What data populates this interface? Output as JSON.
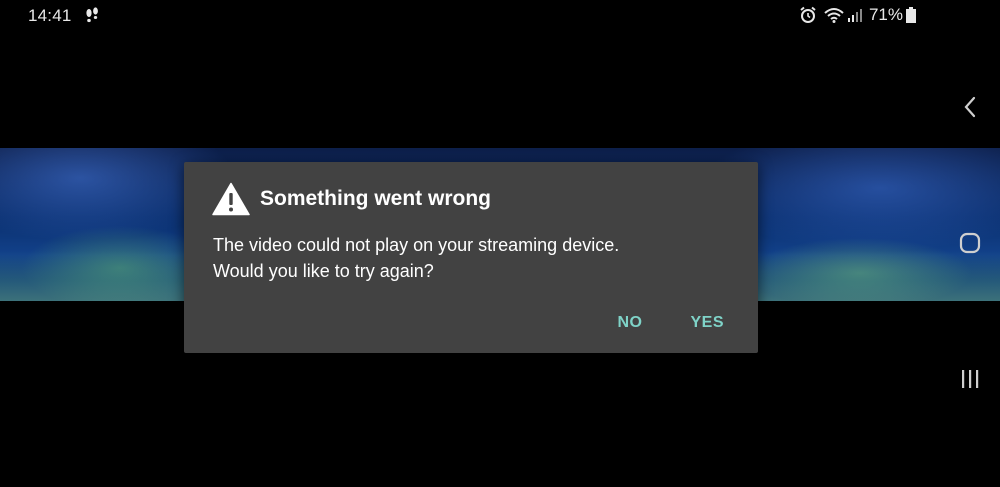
{
  "status_bar": {
    "time": "14:41",
    "battery_percent": "71%",
    "icons": [
      "steps-icon",
      "alarm-icon",
      "wifi-icon",
      "signal-icon",
      "battery-icon"
    ]
  },
  "video": {
    "state": "paused-with-error"
  },
  "dialog": {
    "icon": "warning-icon",
    "title": "Something went wrong",
    "message_line1": "The video could not play on your streaming device.",
    "message_line2": "Would you like to try again?",
    "no_label": "NO",
    "yes_label": "YES",
    "accent_color": "#7fd3c8",
    "background_color": "#424242"
  },
  "nav_bar": {
    "buttons": [
      "back-icon",
      "home-icon",
      "recents-icon"
    ]
  }
}
